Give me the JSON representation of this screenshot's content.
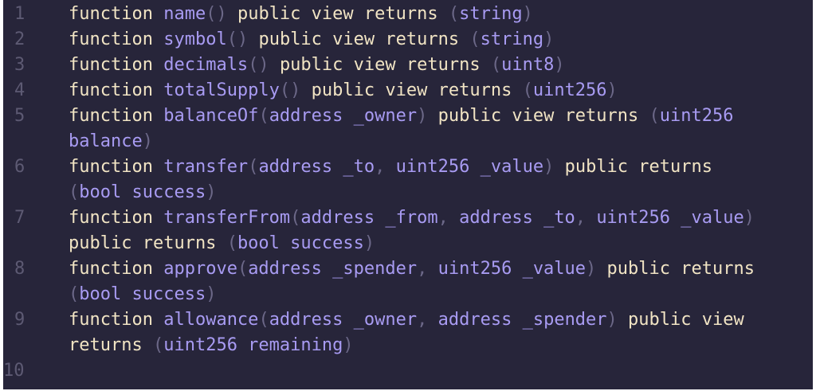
{
  "colors": {
    "background": "#27253a",
    "line_number": "#5d5a73",
    "keyword": "#f1e4c4",
    "identifier": "#a89bf2",
    "punctuation": "#6c6888"
  },
  "lines": [
    {
      "number": "1",
      "rows": [
        [
          {
            "t": "function ",
            "c": "kw"
          },
          {
            "t": "name",
            "c": "fn"
          },
          {
            "t": "() ",
            "c": "pn"
          },
          {
            "t": "public view returns ",
            "c": "kw"
          },
          {
            "t": "(",
            "c": "pn"
          },
          {
            "t": "string",
            "c": "ty"
          },
          {
            "t": ")",
            "c": "pn"
          }
        ]
      ]
    },
    {
      "number": "2",
      "rows": [
        [
          {
            "t": "function ",
            "c": "kw"
          },
          {
            "t": "symbol",
            "c": "fn"
          },
          {
            "t": "() ",
            "c": "pn"
          },
          {
            "t": "public view returns ",
            "c": "kw"
          },
          {
            "t": "(",
            "c": "pn"
          },
          {
            "t": "string",
            "c": "ty"
          },
          {
            "t": ")",
            "c": "pn"
          }
        ]
      ]
    },
    {
      "number": "3",
      "rows": [
        [
          {
            "t": "function ",
            "c": "kw"
          },
          {
            "t": "decimals",
            "c": "fn"
          },
          {
            "t": "() ",
            "c": "pn"
          },
          {
            "t": "public view returns ",
            "c": "kw"
          },
          {
            "t": "(",
            "c": "pn"
          },
          {
            "t": "uint8",
            "c": "ty"
          },
          {
            "t": ")",
            "c": "pn"
          }
        ]
      ]
    },
    {
      "number": "4",
      "rows": [
        [
          {
            "t": "function ",
            "c": "kw"
          },
          {
            "t": "totalSupply",
            "c": "fn"
          },
          {
            "t": "() ",
            "c": "pn"
          },
          {
            "t": "public view returns ",
            "c": "kw"
          },
          {
            "t": "(",
            "c": "pn"
          },
          {
            "t": "uint256",
            "c": "ty"
          },
          {
            "t": ")",
            "c": "pn"
          }
        ]
      ]
    },
    {
      "number": "5",
      "rows": [
        [
          {
            "t": "function ",
            "c": "kw"
          },
          {
            "t": "balanceOf",
            "c": "fn"
          },
          {
            "t": "(",
            "c": "pn"
          },
          {
            "t": "address _owner",
            "c": "ty"
          },
          {
            "t": ") ",
            "c": "pn"
          },
          {
            "t": "public view returns ",
            "c": "kw"
          },
          {
            "t": "(",
            "c": "pn"
          },
          {
            "t": "uint256",
            "c": "ty"
          }
        ],
        [
          {
            "t": "balance",
            "c": "ty"
          },
          {
            "t": ")",
            "c": "pn"
          }
        ]
      ]
    },
    {
      "number": "6",
      "rows": [
        [
          {
            "t": "function ",
            "c": "kw"
          },
          {
            "t": "transfer",
            "c": "fn"
          },
          {
            "t": "(",
            "c": "pn"
          },
          {
            "t": "address _to",
            "c": "ty"
          },
          {
            "t": ", ",
            "c": "pn"
          },
          {
            "t": "uint256 _value",
            "c": "ty"
          },
          {
            "t": ") ",
            "c": "pn"
          },
          {
            "t": "public returns",
            "c": "kw"
          }
        ],
        [
          {
            "t": "(",
            "c": "pn"
          },
          {
            "t": "bool success",
            "c": "ty"
          },
          {
            "t": ")",
            "c": "pn"
          }
        ]
      ]
    },
    {
      "number": "7",
      "rows": [
        [
          {
            "t": "function ",
            "c": "kw"
          },
          {
            "t": "transferFrom",
            "c": "fn"
          },
          {
            "t": "(",
            "c": "pn"
          },
          {
            "t": "address _from",
            "c": "ty"
          },
          {
            "t": ", ",
            "c": "pn"
          },
          {
            "t": "address _to",
            "c": "ty"
          },
          {
            "t": ", ",
            "c": "pn"
          },
          {
            "t": "uint256 _value",
            "c": "ty"
          },
          {
            "t": ")",
            "c": "pn"
          }
        ],
        [
          {
            "t": "public returns ",
            "c": "kw"
          },
          {
            "t": "(",
            "c": "pn"
          },
          {
            "t": "bool success",
            "c": "ty"
          },
          {
            "t": ")",
            "c": "pn"
          }
        ]
      ]
    },
    {
      "number": "8",
      "rows": [
        [
          {
            "t": "function ",
            "c": "kw"
          },
          {
            "t": "approve",
            "c": "fn"
          },
          {
            "t": "(",
            "c": "pn"
          },
          {
            "t": "address _spender",
            "c": "ty"
          },
          {
            "t": ", ",
            "c": "pn"
          },
          {
            "t": "uint256 _value",
            "c": "ty"
          },
          {
            "t": ") ",
            "c": "pn"
          },
          {
            "t": "public returns",
            "c": "kw"
          }
        ],
        [
          {
            "t": "(",
            "c": "pn"
          },
          {
            "t": "bool success",
            "c": "ty"
          },
          {
            "t": ")",
            "c": "pn"
          }
        ]
      ]
    },
    {
      "number": "9",
      "rows": [
        [
          {
            "t": "function ",
            "c": "kw"
          },
          {
            "t": "allowance",
            "c": "fn"
          },
          {
            "t": "(",
            "c": "pn"
          },
          {
            "t": "address _owner",
            "c": "ty"
          },
          {
            "t": ", ",
            "c": "pn"
          },
          {
            "t": "address _spender",
            "c": "ty"
          },
          {
            "t": ") ",
            "c": "pn"
          },
          {
            "t": "public view",
            "c": "kw"
          }
        ],
        [
          {
            "t": "returns ",
            "c": "kw"
          },
          {
            "t": "(",
            "c": "pn"
          },
          {
            "t": "uint256 remaining",
            "c": "ty"
          },
          {
            "t": ")",
            "c": "pn"
          }
        ]
      ]
    },
    {
      "number": "10",
      "rows": [
        []
      ]
    }
  ]
}
